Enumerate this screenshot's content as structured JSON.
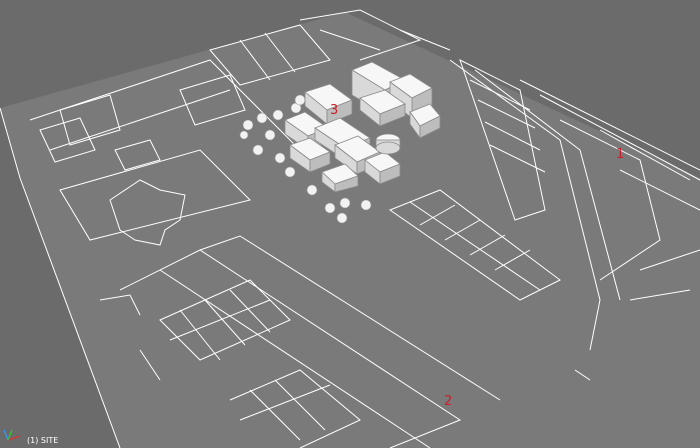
{
  "viewport": {
    "label": "(1) SITE",
    "colors": {
      "background": "#6b6b6b",
      "ground": "#7a7a7a",
      "lines": "#ffffff",
      "buildings": "#f2f2f2",
      "marker": "#c8202a"
    },
    "markers": [
      {
        "text": "1"
      },
      {
        "text": "2"
      },
      {
        "text": "3"
      }
    ],
    "icons": [
      "axis-tripod-icon"
    ]
  }
}
